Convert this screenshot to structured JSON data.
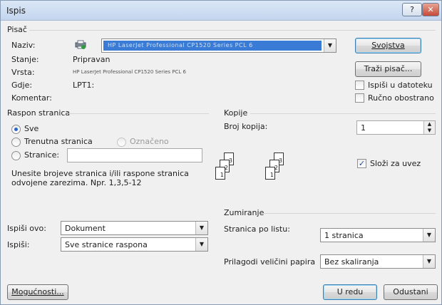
{
  "window": {
    "title": "Ispis",
    "help_label": "?",
    "close_label": "✕"
  },
  "printer": {
    "group_label": "Pisač",
    "name_label": "Naziv:",
    "name_value": "HP LaserJet Professional CP1520 Series PCL 6",
    "status_label": "Stanje:",
    "status_value": "Pripravan",
    "type_label": "Vrsta:",
    "type_value": "HP LaserJet Professional CP1520 Series PCL 6",
    "where_label": "Gdje:",
    "where_value": "LPT1:",
    "comment_label": "Komentar:",
    "properties_button": "Svojstva",
    "find_button": "Traži pisač...",
    "print_to_file": "Ispiši u datoteku",
    "manual_duplex": "Ručno obostrano"
  },
  "page_range": {
    "group_label": "Raspon stranica",
    "all": "Sve",
    "current": "Trenutna stranica",
    "selection": "Označeno",
    "pages": "Stranice:",
    "pages_value": "",
    "hint_line1": "Unesite brojeve stranica i/ili raspone stranica",
    "hint_line2": "odvojene zarezima. Npr. 1,3,5-12"
  },
  "copies": {
    "group_label": "Kopije",
    "count_label": "Broj kopija:",
    "count_value": "1",
    "collate": "Složi za uvez",
    "stack1": [
      "1",
      "2",
      "3"
    ],
    "stack2": [
      "1",
      "2",
      "3"
    ]
  },
  "print_what": {
    "label": "Ispiši ovo:",
    "value": "Dokument"
  },
  "print": {
    "label": "Ispiši:",
    "value": "Sve stranice raspona"
  },
  "zoom": {
    "group_label": "Zumiranje",
    "pages_per_sheet_label": "Stranica po listu:",
    "pages_per_sheet_value": "1 stranica",
    "scale_label": "Prilagodi veličini papira",
    "scale_value": "Bez skaliranja"
  },
  "buttons": {
    "options": "Mogućnosti...",
    "ok": "U redu",
    "cancel": "Odustani"
  },
  "colors": {
    "selection": "#3a7bd5",
    "accent": "#2b63c6"
  }
}
